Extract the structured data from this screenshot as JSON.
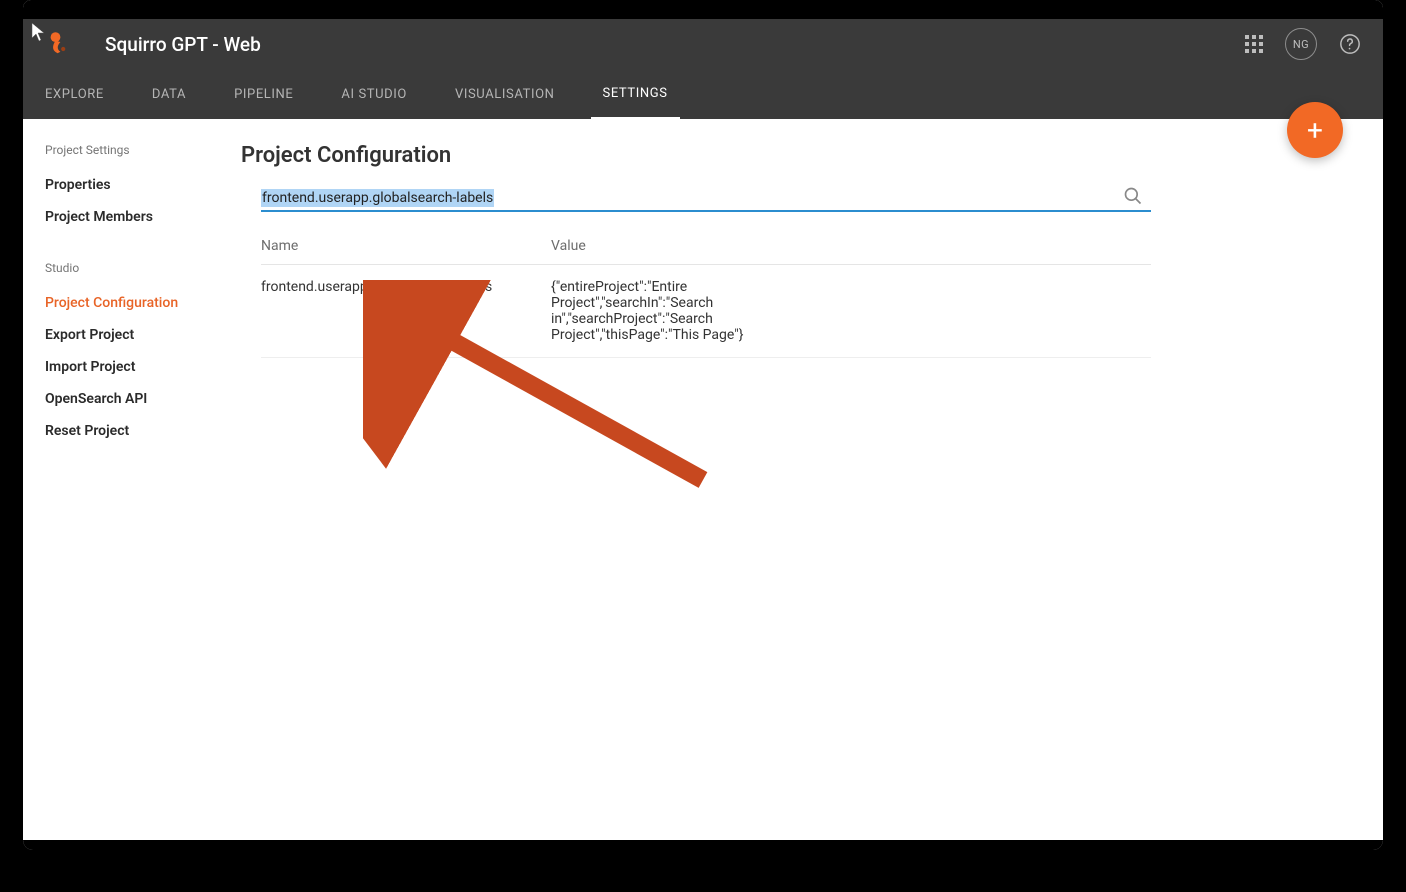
{
  "header": {
    "app_title": "Squirro GPT - Web",
    "avatar_initials": "NG",
    "nav": [
      {
        "label": "EXPLORE"
      },
      {
        "label": "DATA"
      },
      {
        "label": "PIPELINE"
      },
      {
        "label": "AI STUDIO"
      },
      {
        "label": "VISUALISATION"
      },
      {
        "label": "SETTINGS"
      }
    ],
    "active_nav": "SETTINGS"
  },
  "sidebar": {
    "section1_title": "Project Settings",
    "section1_items": [
      {
        "label": "Properties"
      },
      {
        "label": "Project Members"
      }
    ],
    "section2_title": "Studio",
    "section2_items": [
      {
        "label": "Project Configuration",
        "active": true
      },
      {
        "label": "Export Project"
      },
      {
        "label": "Import Project"
      },
      {
        "label": "OpenSearch API"
      },
      {
        "label": "Reset Project"
      }
    ]
  },
  "main": {
    "page_title": "Project Configuration",
    "search_value": "frontend.userapp.globalsearch-labels",
    "table": {
      "col_name": "Name",
      "col_value": "Value",
      "rows": [
        {
          "name": "frontend.userapp.globalsearch-labels",
          "value": "{\"entireProject\":\"Entire Project\",\"searchIn\":\"Search in\",\"searchProject\":\"Search Project\",\"thisPage\":\"This Page\"}"
        }
      ]
    }
  },
  "fab": {
    "plus": "+"
  },
  "colors": {
    "accent_orange": "#f26925",
    "link_blue": "#2b8dcf"
  }
}
